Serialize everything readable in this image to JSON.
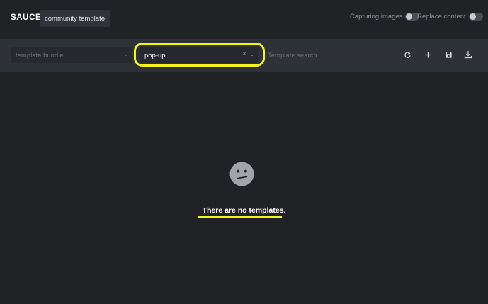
{
  "header": {
    "brand": "SAUCE",
    "template_select": {
      "value": "community template",
      "icon": "chevron-down-icon"
    },
    "toggles": [
      {
        "label": "Capturing images",
        "on": false
      },
      {
        "label": "Replace content",
        "on": false
      }
    ]
  },
  "toolbar": {
    "bundle_select": {
      "placeholder": "template bundle",
      "icon": "chevron-down-icon"
    },
    "type_select": {
      "value": "pop-up",
      "clear_icon": "close-icon",
      "icon": "chevron-down-icon"
    },
    "search": {
      "placeholder": "Template search...",
      "value": ""
    },
    "actions": [
      {
        "name": "refresh",
        "icon": "refresh-icon"
      },
      {
        "name": "add",
        "icon": "plus-icon"
      },
      {
        "name": "save",
        "icon": "save-icon"
      },
      {
        "name": "download",
        "icon": "download-icon"
      }
    ]
  },
  "main": {
    "empty_icon": "neutral-face-icon",
    "empty_message": "There are no templates."
  },
  "colors": {
    "background": "#202225",
    "toolbar": "#2e3136",
    "field": "#26292d",
    "highlight": "#f4f221"
  }
}
